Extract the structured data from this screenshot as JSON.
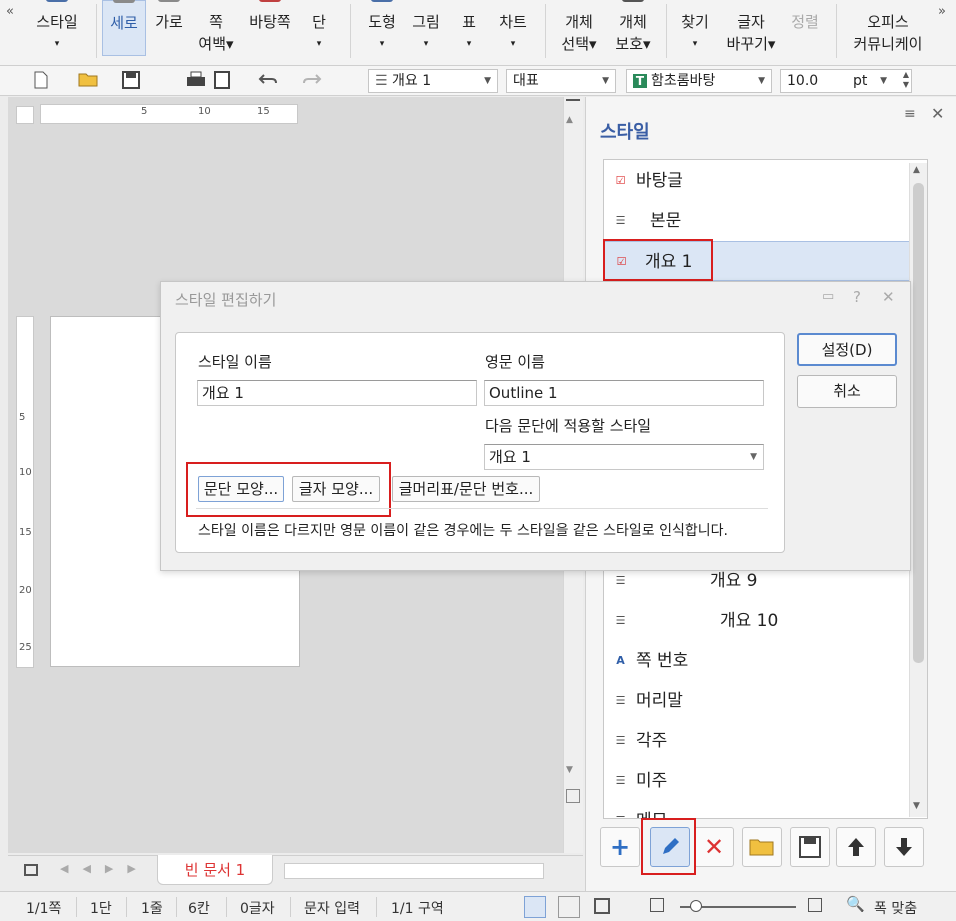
{
  "ribbon": {
    "items": [
      {
        "l1": "스타일",
        "l2": "▾"
      },
      {
        "l1": "세로",
        "l2": ""
      },
      {
        "l1": "가로",
        "l2": ""
      },
      {
        "l1": "쪽",
        "l2": "여백▾"
      },
      {
        "l1": "바탕쪽",
        "l2": ""
      },
      {
        "l1": "단",
        "l2": "▾"
      },
      {
        "l1": "도형",
        "l2": "▾"
      },
      {
        "l1": "그림",
        "l2": "▾"
      },
      {
        "l1": "표",
        "l2": "▾"
      },
      {
        "l1": "차트",
        "l2": "▾"
      },
      {
        "l1": "개체",
        "l2": "선택▾"
      },
      {
        "l1": "개체",
        "l2": "보호▾"
      },
      {
        "l1": "찾기",
        "l2": "▾"
      },
      {
        "l1": "글자",
        "l2": "바꾸기▾"
      },
      {
        "l1": "정렬",
        "l2": ""
      },
      {
        "l1": "오피스",
        "l2": "커뮤니케이"
      }
    ],
    "left_chevron": "«",
    "right_chevron": "»"
  },
  "toolbar": {
    "style_combo": "개요 1",
    "font_lang_combo": "대표",
    "font_combo": "함초롬바탕",
    "size_value": "10.0",
    "size_unit": "pt",
    "font_badge": "T"
  },
  "ruler": {
    "marks": [
      "5",
      "10",
      "15"
    ],
    "vmarks": [
      "5",
      "10",
      "15",
      "20",
      "25"
    ]
  },
  "document": {
    "tab_label": "빈 문서 1"
  },
  "status": {
    "page": "1/1쪽",
    "column": "1단",
    "line": "1줄",
    "char_col": "6칸",
    "chars": "0글자",
    "mode": "문자 입력",
    "section": "1/1 구역",
    "zoom_label": "폭 맞춤"
  },
  "style_panel": {
    "title": "스타일",
    "items": [
      {
        "label": "바탕글",
        "icon": "para-check-icon"
      },
      {
        "label": "본문",
        "icon": "para-icon"
      },
      {
        "label": "개요 1",
        "icon": "para-check-icon"
      },
      {
        "label": "개요 9",
        "icon": "para-icon"
      },
      {
        "label": "개요 10",
        "icon": "para-icon"
      },
      {
        "label": "쪽 번호",
        "icon": "char-style-icon"
      },
      {
        "label": "머리말",
        "icon": "para-icon"
      },
      {
        "label": "각주",
        "icon": "para-icon"
      },
      {
        "label": "미주",
        "icon": "para-icon"
      },
      {
        "label": "메모",
        "icon": "para-icon"
      }
    ]
  },
  "dialog": {
    "title": "스타일 편집하기",
    "style_name_label": "스타일 이름",
    "style_name_value": "개요 1",
    "english_name_label": "영문 이름",
    "english_name_value": "Outline 1",
    "next_style_label": "다음 문단에 적용할 스타일",
    "next_style_value": "개요 1",
    "para_shape_btn": "문단 모양...",
    "char_shape_btn": "글자 모양...",
    "bullet_btn": "글머리표/문단 번호...",
    "note": "스타일 이름은 다르지만 영문 이름이 같은 경우에는 두 스타일을 같은 스타일로 인식합니다.",
    "ok_btn": "설정(D)",
    "cancel_btn": "취소"
  }
}
